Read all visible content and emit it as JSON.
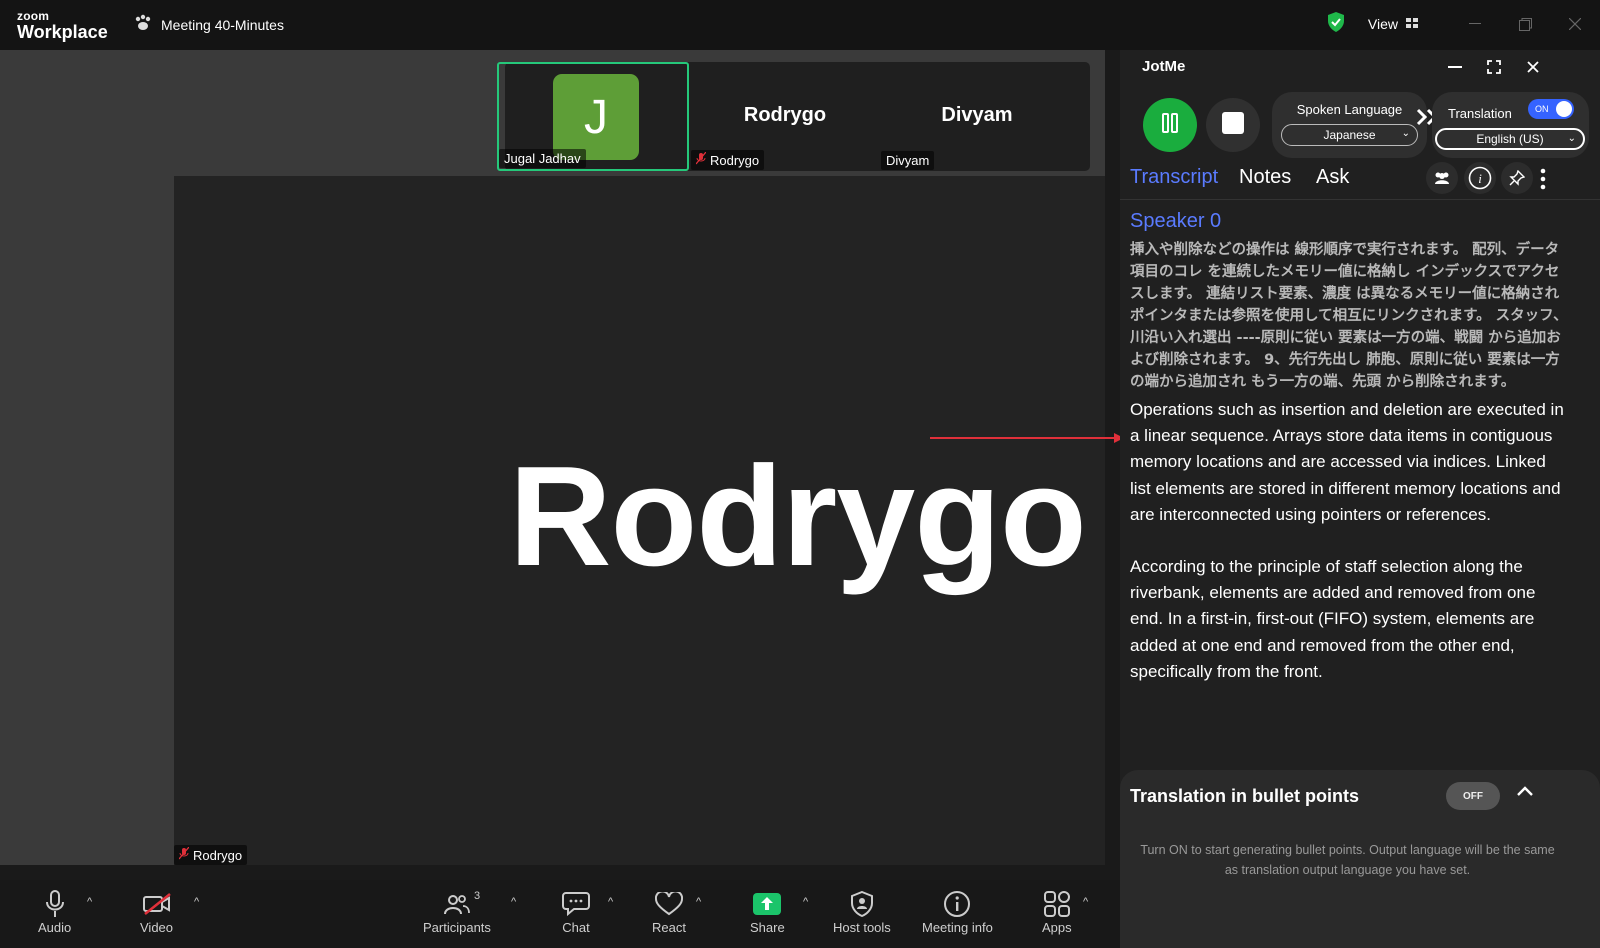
{
  "titlebar": {
    "logo_top": "zoom",
    "logo_bottom": "Workplace",
    "meeting_title": "Meeting 40-Minutes",
    "view_label": "View"
  },
  "thumbnails": [
    {
      "tag": "Jugal Jadhav",
      "avatar_letter": "J",
      "avatar_color": "#5e9e37"
    },
    {
      "display_name": "Rodrygo",
      "tag": "Rodrygo"
    },
    {
      "display_name": "Divyam",
      "tag": "Divyam"
    }
  ],
  "active_speaker": {
    "name": "Rodrygo",
    "tag": "Rodrygo"
  },
  "toolbar": {
    "audio": "Audio",
    "video": "Video",
    "participants": "Participants",
    "participants_count": "3",
    "chat": "Chat",
    "react": "React",
    "share": "Share",
    "host_tools": "Host tools",
    "meeting_info": "Meeting info",
    "apps": "Apps"
  },
  "jotme": {
    "title": "JotMe",
    "spoken_language_label": "Spoken Language",
    "spoken_language_value": "Japanese",
    "translation_label": "Translation",
    "translation_toggle": "ON",
    "translation_value": "English (US)",
    "tabs": [
      "Transcript",
      "Notes",
      "Ask"
    ],
    "active_tab": "Transcript",
    "speaker": "Speaker 0",
    "japanese_text": "挿入や削除などの操作は 線形順序で実行されます。 配列、データ項目のコレ を連続したメモリー値に格納し インデックスでアクセスします。 連結リスト要素、濃度 は異なるメモリー値に格納され ポインタまたは参照を使用して相互にリンクされます。 スタッフ、川沿い入れ選出 ----原則に従い 要素は一方の端、戦闘 から追加および削除されます。 9、先行先出し 肺胞、原則に従い 要素は一方の端から追加され もう一方の端、先頭 から削除されます。",
    "english_p1": "Operations such as insertion and deletion are executed in a linear sequence. Arrays store data items in contiguous memory locations and are accessed via indices. Linked list elements are stored in different memory locations and are interconnected using pointers or references.",
    "english_p2": "According to the principle of staff selection along the riverbank, elements are added and removed from one end. In a first-in, first-out (FIFO) system, elements are added at one end and removed from the other end, specifically from the front.",
    "bullet_title": "Translation in bullet points",
    "bullet_toggle": "OFF",
    "bullet_desc": "Turn ON to start generating bullet points. Output language will be the same as translation output language you have set."
  },
  "colors": {
    "accent_blue": "#5a7bff",
    "active_green": "#25c87a",
    "record_green": "#1aad3e",
    "share_green": "#1bc46a",
    "mute_red": "#e0303a"
  }
}
